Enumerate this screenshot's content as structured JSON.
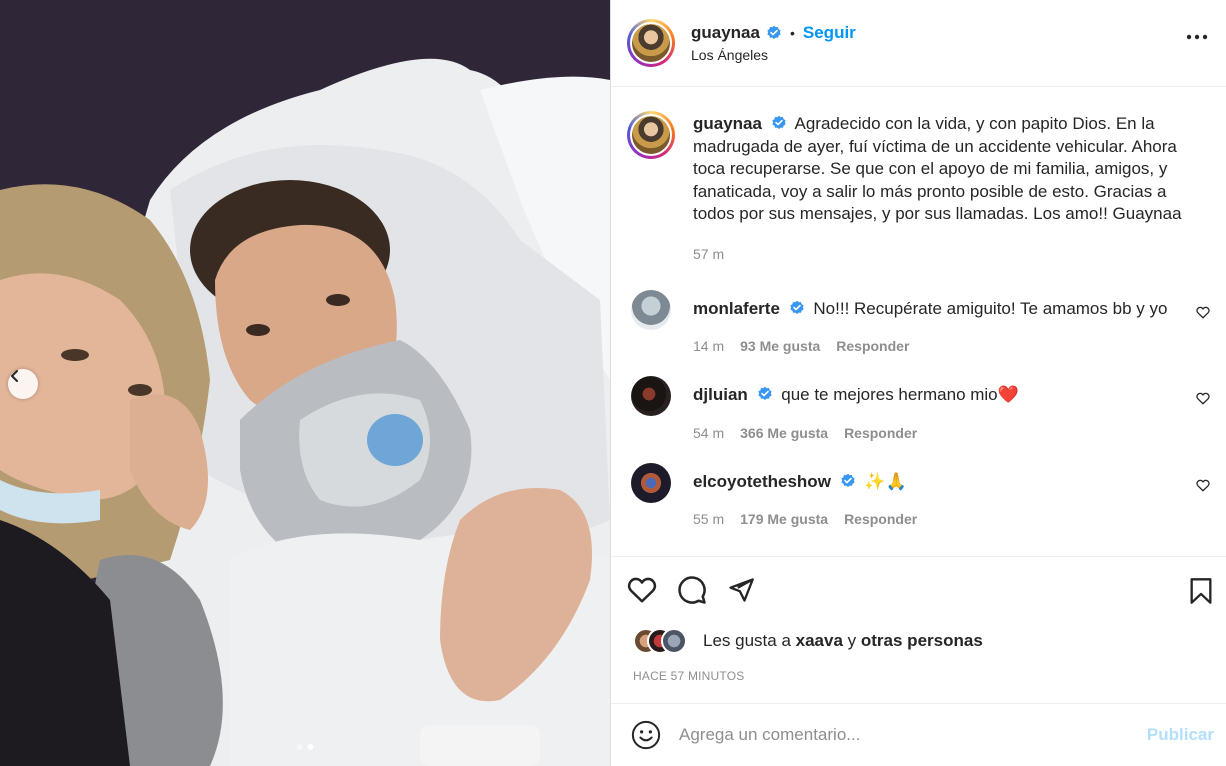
{
  "post": {
    "author": "guaynaa",
    "follow_label": "Seguir",
    "separator": "•",
    "location": "Los Ángeles",
    "caption": "Agradecido con la vida, y con papito Dios. En la madrugada de ayer, fuí víctima de un accidente vehicular. Ahora toca recuperarse. Se que con el apoyo de mi familia, amigos, y fanaticada, voy a salir lo más pronto posible de esto. Gracias a todos por sus mensajes, y por sus llamadas. Los amo!! Guaynaa",
    "caption_time": "57 m",
    "carousel": {
      "slides": 2,
      "active_slide": 2
    }
  },
  "comments": [
    {
      "user": "monlaferte",
      "text": "No!!! Recupérate amiguito! Te amamos bb y yo",
      "time": "14 m",
      "likes": "93 Me gusta",
      "reply": "Responder"
    },
    {
      "user": "djluian",
      "text": "que te mejores hermano mio",
      "emoji": "❤️",
      "time": "54 m",
      "likes": "366 Me gusta",
      "reply": "Responder"
    },
    {
      "user": "elcoyotetheshow",
      "text": "",
      "emoji": "✨🙏",
      "time": "55 m",
      "likes": "179 Me gusta",
      "reply": "Responder"
    }
  ],
  "likes": {
    "prefix": "Les gusta a",
    "user": "xaava",
    "conj": "y",
    "others": "otras personas"
  },
  "timestamp": "HACE 57 MINUTOS",
  "add_comment": {
    "placeholder": "Agrega un comentario...",
    "publish_label": "Publicar"
  },
  "colors": {
    "link": "#0095f6",
    "verified": "#3897f0",
    "publish_disabled": "#b2dffc",
    "muted": "#8e8e8e"
  },
  "icons": [
    "more-options-icon",
    "verified-icon",
    "heart-icon",
    "comment-icon",
    "share-icon",
    "bookmark-icon",
    "emoji-icon",
    "chevron-left-icon"
  ]
}
